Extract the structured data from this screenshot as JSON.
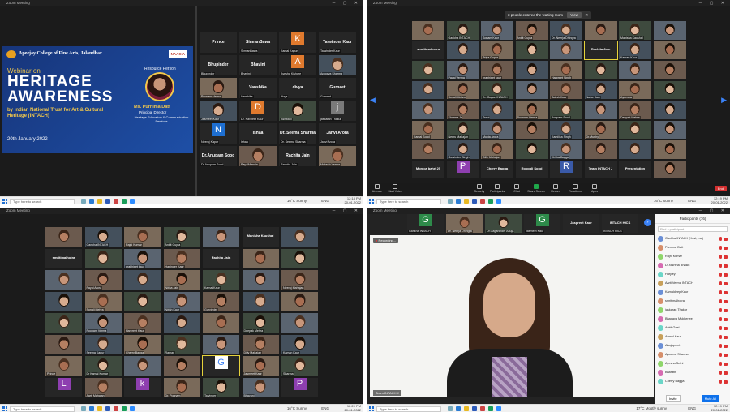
{
  "app": "Zoom Meeting",
  "taskbar": {
    "search_placeholder": "Type here to search",
    "weather": "16°C Sunny",
    "weather_q4": "17°C Mostly sunny",
    "lang": "ENG",
    "time_q1": "12:18 PM",
    "date_q1": "20-01-2022",
    "time_q2": "12:19 PM",
    "date_q2": "20-01-2022",
    "time_q3": "12:20 PM",
    "date_q3": "20-01-2022",
    "time_q4": "12:19 PM",
    "date_q4": "20-01-2022"
  },
  "poster": {
    "college": "Apeejay College of Fine Arts, Jalandhar",
    "badge": "NAAC A",
    "webinar_on": "Webinar on",
    "title_1": "HERITAGE",
    "title_2": "AWARENESS",
    "subtitle": "by Indian National Trust for Art & Cultural Heritage (INTACH)",
    "date": "20th January 2022",
    "resource_label": "Resource Person",
    "speaker": "Ms. Purnima Datt",
    "speaker_role": "Principal Director",
    "speaker_dept": "Heritage Education & Communication Services"
  },
  "q1_grid": [
    {
      "label": "Prince",
      "sub": ""
    },
    {
      "label": "SimranBawa",
      "sub": "SimranBawa"
    },
    {
      "label": "K",
      "sub": "Kamal Kapur"
    },
    {
      "label": "Talwinder Kaur",
      "sub": "Talwinder Kaur"
    },
    {
      "label": "Bhupinder",
      "sub": "Bhupinder"
    },
    {
      "label": "Bhavini",
      "sub": "Bhavini"
    },
    {
      "label": "A",
      "sub": "Ayesha Kishore"
    },
    {
      "label": "",
      "sub": "Apoorva Sharma"
    },
    {
      "label": "",
      "sub": "Poonam Verma"
    },
    {
      "label": "Vanshika",
      "sub": "Vanshika"
    },
    {
      "label": "divya",
      "sub": "divya"
    },
    {
      "label": "Gurneet",
      "sub": "Gurneet"
    },
    {
      "label": "",
      "sub": "Jasmeet Kaur"
    },
    {
      "label": "D",
      "sub": "Dr. Navneet Kaur"
    },
    {
      "label": "",
      "sub": "Ashwani"
    },
    {
      "label": "j",
      "sub": "jaskaran Thakur"
    },
    {
      "label": "N",
      "sub": "Neeraj Kapur"
    },
    {
      "label": "Ishaa",
      "sub": "Ishaa"
    },
    {
      "label": "Dr. Seema Sharma",
      "sub": "Dr. Seema Sharma"
    },
    {
      "label": "Janvi Arora",
      "sub": "Janvi Arora"
    },
    {
      "label": "Dr.Anupam Sood",
      "sub": "Dr.Anupam Sood"
    },
    {
      "label": "",
      "sub": "PayalMandia"
    },
    {
      "label": "Rachita Jain",
      "sub": "Rachita Jain"
    },
    {
      "label": "",
      "sub": "Mukesh Verma"
    }
  ],
  "q2": {
    "waiting_msg": "3 people entered the waiting room",
    "view_button": "View",
    "tiles": [
      "",
      "Gankha INTACH",
      "Sonam Kaur",
      "Ankit Gupta",
      "Dr. Neerja Dhingra",
      "",
      "Manisha Kaushal",
      "",
      "smritimalhotra",
      "",
      "Priya Gupta",
      "",
      "",
      "Rachita Jain",
      "Kaman Kaur",
      "",
      "",
      "Payal Verma",
      "prabhjeet kaur",
      "",
      "Harpreet Singh",
      "",
      "",
      "",
      "",
      "Sonali Mehra",
      "Dr. Gagan INTACH",
      "",
      "Satish Kaur",
      "Nafse Kaur",
      "Ayeesha",
      "",
      "",
      "Sharma Jr",
      "Tanvi",
      "Poonam Verma",
      "Anupam Sood",
      "",
      "Deepak Mehra",
      "",
      "Kamal Sood",
      "Neeru Mahajan",
      "Mukta Arora",
      "",
      "Kamilika Singh",
      "Dr.Murthy",
      "",
      "",
      "",
      "Gurvinder Singh",
      "Dilly Mahajan",
      "",
      "Kirtika Bagga",
      "",
      "",
      "",
      "Monica bahri 25",
      "P",
      "Cherry Bagga",
      "Roopali Sood",
      "R",
      "Team INTACH J",
      "Presentation",
      ""
    ],
    "toolbar": [
      "Unmute",
      "Start Video",
      "Security",
      "Participants",
      "Chat",
      "Share Screen",
      "Record",
      "Reactions",
      "Apps"
    ],
    "end": "End"
  },
  "q3": {
    "tiles": [
      "",
      "Gankha INTACH",
      "Rajni Kumar",
      "Ankit Gupta",
      "",
      "Manisha Kaushal",
      "",
      "smritimalhotra",
      "",
      "prabhjeet kaur",
      "Harjinder Kaur",
      "Rachita Jain",
      "",
      "",
      "",
      "Payal Arora",
      "",
      "Nitika Jain",
      "Kamal Kaur",
      "",
      "Neeraj Mahajan",
      "",
      "Sonali Mehra",
      "",
      "Nitish Kaur",
      "Gurvinder",
      "",
      "",
      "",
      "Poonam Verma",
      "Harpreet Kaur",
      "",
      "",
      "Deepak Mehra",
      "",
      "",
      "Seema Kapur",
      "Cherry Bagga",
      "Raman",
      "",
      "Dilly Mahajan",
      "Kaman Kaur",
      "Prince",
      "Dr Kamal Kumar",
      "",
      "",
      "G",
      "Jasmeet Kaur",
      "Sharma",
      "L",
      "Aarti Mahajan",
      "k",
      "Dr. Poonam",
      "Talvinder",
      "Bhavani",
      "P"
    ]
  },
  "q4": {
    "strip": [
      {
        "label": "G",
        "sub": "Gankha INTACH"
      },
      {
        "label": "",
        "sub": "Dr. Neerja Dhingra"
      },
      {
        "label": "",
        "sub": "Dr.Gaganinder Ahuja"
      },
      {
        "label": "G",
        "sub": "Jasmeet Kaur"
      },
      {
        "label": "Jaspreet Kaur",
        "sub": ""
      },
      {
        "label": "INTACH HICS",
        "sub": "INTACH HICS"
      }
    ],
    "recording": "Recording...",
    "speaker_label": "Team INTACH J",
    "panel_title": "Participants (76)",
    "panel_search": "Find a participant",
    "participants": [
      "Gankha INTACH (Host, me)",
      "Purnima Datt",
      "Rajni Kumar",
      "Dr.Nishtha Bhasin",
      "Harjiley",
      "Aarti Verma INTACH",
      "Kamaldeep Kaur",
      "smritimalhotra",
      "jaskaran Thakur",
      "Bhagaya Mukherjee",
      "Ankit Goel",
      "Anmol Kaur",
      "Ahujapreet",
      "Apoorva Sharma",
      "Ayesha Sethi",
      "Bharath",
      "Cherry Bagga"
    ],
    "invite": "Invite",
    "mute_all": "Mute All"
  },
  "colors": {
    "zoom_bg": "#1b1b1b",
    "tile_bg": "#262626",
    "poster_blue": "#1e3f8c",
    "active_speaker": "#e5d23b",
    "end_red": "#d32f2f"
  }
}
